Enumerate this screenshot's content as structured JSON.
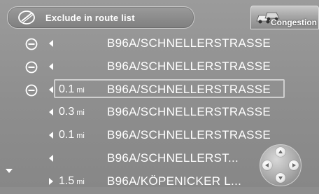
{
  "header": {
    "exclude_label": "Exclude in route list",
    "congestion_label": "Congestion"
  },
  "rows": [
    {
      "distance": "",
      "unit": "",
      "street": "B96A/SCHNELLERSTRASSE",
      "exclude_icon": "minus-circle-icon",
      "direction": "left",
      "selected": false
    },
    {
      "distance": "",
      "unit": "",
      "street": "B96A/SCHNELLERSTRASSE",
      "exclude_icon": "minus-circle-icon",
      "direction": "left",
      "selected": false
    },
    {
      "distance": "0.1",
      "unit": "mi",
      "street": "B96A/SCHNELLERSTRASSE",
      "exclude_icon": "minus-circle-icon",
      "direction": "left",
      "selected": true
    },
    {
      "distance": "0.3",
      "unit": "mi",
      "street": "B96A/SCHNELLERSTRASSE",
      "exclude_icon": "",
      "direction": "left",
      "selected": false
    },
    {
      "distance": "0.1",
      "unit": "mi",
      "street": "B96A/SCHNELLERSTRASSE",
      "exclude_icon": "",
      "direction": "left",
      "selected": false
    },
    {
      "distance": "",
      "unit": "",
      "street": "B96A/SCHNELLERST...",
      "exclude_icon": "",
      "direction": "left",
      "selected": false
    },
    {
      "distance": "1.5",
      "unit": "mi",
      "street": "B96A/KÖPENICKER L...",
      "exclude_icon": "",
      "direction": "right",
      "selected": false
    }
  ],
  "colors": {
    "background": "#8e8e8e",
    "text": "#ffffff",
    "selection_border": "#cfcfcf"
  }
}
